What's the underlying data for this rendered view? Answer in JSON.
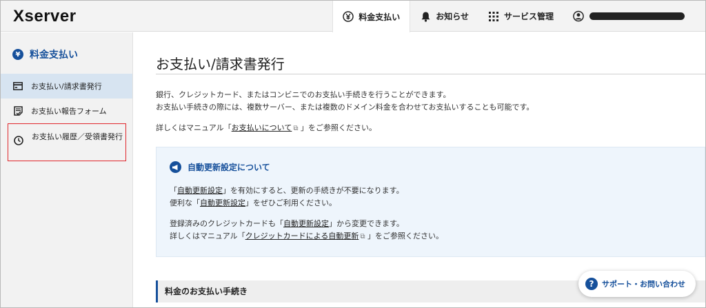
{
  "header": {
    "logo": "Xserver",
    "nav": [
      {
        "label": "料金支払い",
        "icon": "yen-circle-icon"
      },
      {
        "label": "お知らせ",
        "icon": "bell-icon"
      },
      {
        "label": "サービス管理",
        "icon": "grid-icon"
      }
    ],
    "user_icon": "user-icon"
  },
  "sidebar": {
    "title": "料金支払い",
    "title_icon_glyph": "¥",
    "items": [
      {
        "label": "お支払い/請求書発行",
        "icon": "card-icon"
      },
      {
        "label": "お支払い報告フォーム",
        "icon": "form-icon"
      },
      {
        "label": "お支払い履歴／受領書発行",
        "icon": "clock-icon"
      }
    ]
  },
  "main": {
    "title": "お支払い/請求書発行",
    "intro_line1": "銀行、クレジットカード、またはコンビニでのお支払い手続きを行うことができます。",
    "intro_line2": "お支払い手続きの際には、複数サーバー、または複数のドメイン料金を合わせてお支払いすることも可能です。",
    "manual_prefix": "詳しくはマニュアル「",
    "manual_link": "お支払いについて",
    "manual_suffix": "」をご参照ください。",
    "notice": {
      "title": "自動更新設定について",
      "l1_pre": "「",
      "l1_link": "自動更新設定",
      "l1_post": "」を有効にすると、更新の手続きが不要になります。",
      "l2_pre": "便利な「",
      "l2_link": "自動更新設定",
      "l2_post": "」をぜひご利用ください。",
      "l3_pre": "登録済みのクレジットカードも「",
      "l3_link": "自動更新設定",
      "l3_post": "」から変更できます。",
      "l4_pre": "詳しくはマニュアル「",
      "l4_link": "クレジットカードによる自動更新",
      "l4_post": "」をご参照ください。"
    },
    "section_title": "料金のお支払い手続き"
  },
  "support": {
    "label": "サポート・お問い合わせ",
    "icon_glyph": "?"
  },
  "colors": {
    "brand_blue": "#16509b",
    "highlight_red": "#e0262b",
    "selected_bg": "#d7e4f1"
  }
}
